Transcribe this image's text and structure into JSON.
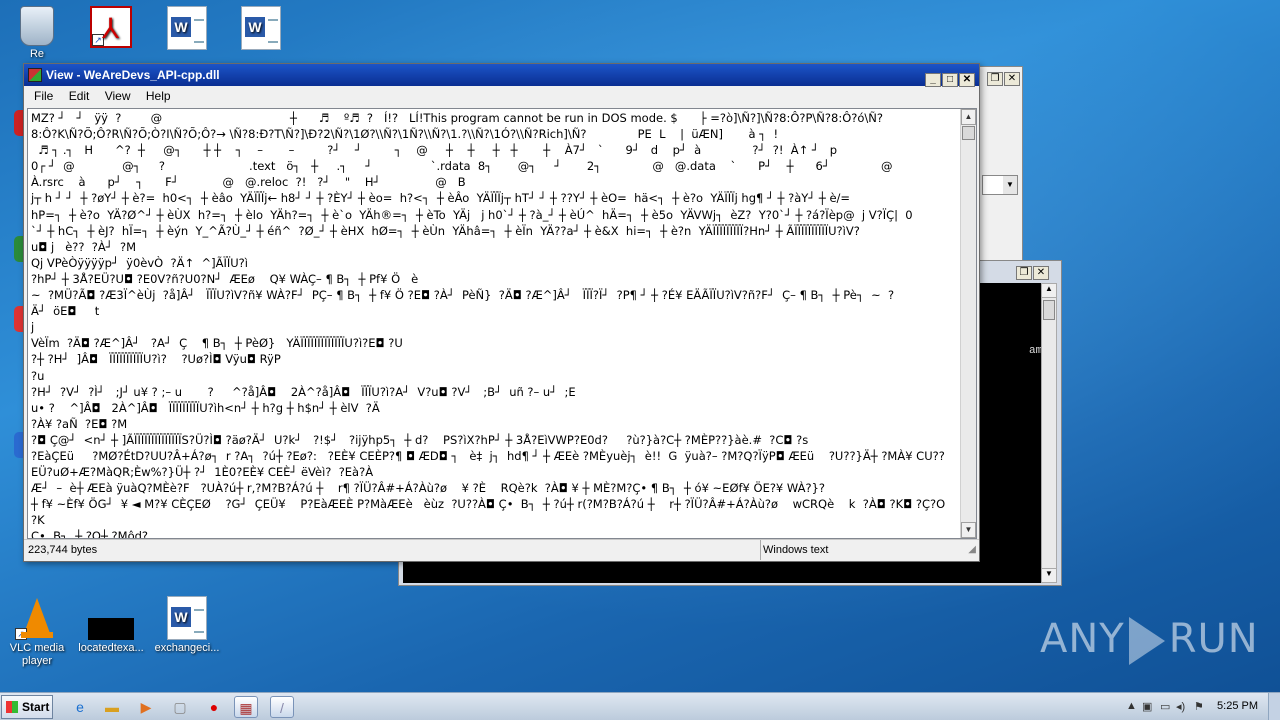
{
  "desktop": {
    "icons_top": [
      {
        "label": "Re",
        "kind": "recycle"
      },
      {
        "label": "",
        "kind": "pdf"
      },
      {
        "label": "",
        "kind": "word"
      },
      {
        "label": "",
        "kind": "word"
      }
    ],
    "icons_bottom": [
      {
        "label": "VLC media player",
        "kind": "vlc"
      },
      {
        "label": "locatedtexa...",
        "kind": "black"
      },
      {
        "label": "exchangeci...",
        "kind": "word"
      }
    ]
  },
  "viewer": {
    "title": "View - WeAreDevs_API-cpp.dll",
    "menu": [
      "File",
      "Edit",
      "View",
      "Help"
    ],
    "lines": [
      "MZ? ┘   ┘   ÿÿ  ?        @                                   ┼      ♬    º♬  ?   Í!?   LÍ!This program cannot be run in DOS mode. $      ├ =?ò]\\Ñ?]\\Ñ?8:Ô?P\\Ñ?8:Ô?ó\\Ñ?",
      "8:Ô?K\\Ñ?Õ;Ô?R\\Ñ?Õ;Ò?I\\Ñ?Õ;Ô?→ \\Ñ?8:Ð?T\\Ñ?]\\Ð?2\\Ñ?\\1Ø?\\\\Ñ?\\1Ñ?\\\\Ñ?\\1.?\\\\Ñ?\\1Ó?\\\\Ñ?Rich]\\Ñ?              PE  L    |  üÆN]       à ┐  !",
      "  ♬ ┐ .┐   H      ^?  ┼     @┐      ┼ ┼    ┐    –       –         ?┘    ┘         ┐    @     ┼    ┼     ┼   ┼       ┼    À7┘   `      9┘   d    p┘  à              ?┘  ?!  À↑ ┘   p",
      "0┌ ┘  @             @┐     ?                       .text   ö┐   ┼     .┐     ┘                `.rdata  8┐       @┐     ┘       2┐              @   @.data    `      P┘    ┼      6┘              @",
      "À.rsrc    à      p┘    ┐      F┘            @   @.reloc  ?!   ?┘    \"    H┘               @   B",
      "j┬ h ┘ ┘  ┼ ?øY┘ ┼ è?=  h0<┐  ┼ èâo  YÄÏÏÏj← h8┘ ┘ ┼ ?ÈY┘ ┼ èo=  h?<┐  ┼ èÂo  YÄÏÏÏj┬ hT┘ ┘ ┼ ??Y┘ ┼ èO=  hä<┐  ┼ è?o  YÄÏÏÏj hg¶ ┘ ┼ ?àY┘ ┼ è/=",
      "hP=┐  ┼ è?o  YÄ?Ø^┘ ┼ èÙX  h?=┐  ┼ èlo  YÄh?=┐  ┼ è`o  YÄh®=┐  ┼ èTo  YÄj   j h0`┘ ┼ ?à_┘ ┼ èÚ^  hÄ=┐  ┼ è5o  YÄVWj┐  èZ?  Y?0`┘ ┼ ?á?Ïèp@  j V?ÏÇ|  0",
      "`┘ ┼ hC┐  ┼ èJ?  hÏ=┐  ┼ èýn  Y_^Ã?Ù_┘ ┼ éñ^  ?Ø_┘ ┼ èHX  hØ=┐  ┼ èÙn  YÄhâ=┐  ┼ èÏn  YÄ??a┘ ┼ è&X  hi=┐  ┼ è?n  YÄÏÏÏÏÏÏÏÏÏ?Hn┘ ┼ ÃÏÏÏÏÏÏÏÏÏÏU?ìV?",
      "u◘ j   è??  ?À┘  ?M",
      "Qj VPèÒÿÿÿÿp┘  ÿ0èvÒ  ?Ä↑  ^]ÃÏÏU?ì",
      "?hP┘ ┼ 3Å?EÜ?U◘ ?E0V?ñ?U0?N┘  ÆEø    Q¥ WÀÇ– ¶ B┐  ┼ Pf¥ Ö   è",
      "~  ?MÜ?Ã◘ ?Æ3Ï^èÙj  ?å]Â┘   ÏÏÏU?ìV?ñ¥ WÀ?F┘  PÇ– ¶ B┐  ┼ f¥ Ö ?E◘ ?À┘  PèÑ}  ?Ä◘ ?Æ^]Â┘   ÏÏÏ?Ï┘  ?P¶ ┘ ┼ ?É¥ EÄÃÏÏU?ìV?ñ?F┘  Ç– ¶ B┐  ┼ Pè┐  ~  ?",
      "Ä┘  öE◘     t",
      "j",
      "VèÏm  ?Ä◘ ?Æ^]Â┘   ?A┘  Ç    ¶ B┐  ┼ PèØ}   YÄÏÏÏÏÏÏÏÏÏÏÏÏÏU?ì?E◘ ?U",
      "?┼ ?H┘  ]Â◘   ÏÏÏÏÏÏÏÏÏÏU?ì?    ?Uø?Ì◘ Vÿu◘ RÿP",
      "?u",
      "?H┘  ?V┘  ?Ì┘   ;J┘ u¥ ? ;– u       ?     ^?å]Â◘    2À^?å]Â◘   ÏÏÏU?ì?A┘  V?u◘ ?V┘   ;B┘  uñ ?– u┘  ;E",
      "u• ?    ^]Â◘   2À^]Â◘   ÏÏÏÏÏÏÏÏÏU?ìh<n┘ ┼ h?g ┼ h$n┘ ┼ èlV  ?Ä",
      "?À¥ ?aÑ  ?E◘ ?M",
      "?◘ Ç@┘  <n┘ ┼ ]ÃÏÏÏÏÏÏÏÏÏÏÏÏÏÏS?Ü?Ì◘ ?äø?Ä┘  U?k┘   ?!$┘   ?ijÿhp5┐  ┼ d?    PS?ìX?hP┘ ┼ 3Å?EìVWP?E0d?     ?ù?}à?C┼ ?MÈP??}àè.#  ?C◘ ?s",
      "?EàÇEü     ?MØ?ÉtD?UU?Â+Á?ø┐  r ?A┐  ?ú┼ ?Eø?:   ?EÈ¥ CEÈP?¶ ◘ ÆD◘ ┐   è‡  j┐  hd¶ ┘ ┼ ÆEè ?MÈyuèj┐  è!!  G  ÿuà?– ?M?Q?ÏÿP◘ ÆEü    ?U??}Ä┼ ?MÀ¥ CU??",
      "EÜ?uØ+Æ?MàQR;Èw%?}Ü┼ ?┘  1È0?EÈ¥ CEÈ┘ ëVèì?  ?Eà?À",
      "Æ┘  –  è┼ ÆEà ÿuàQ?MÈè?F   ?UÀ?ú┼ r,?M?B?Á?ú ┼    r¶ ?ÏÜ?Â#+Á?Àù?ø    ¥ ?È    RQè?k  ?À◘ ¥ ┼ MÈ?M?Ç• ¶ B┐  ┼ ó¥ ~EØf¥ ÖE?¥ WÀ?}?",
      "┼ f¥ ~Èf¥ ÖG┘  ¥ ◄ M?¥ CÈÇEØ    ?G┘  ÇEÜ¥    P?EàÆEÈ P?MàÆEè   èùz  ?U??À◘ Ç•  B┐  ┼ ?ú┼ r(?M?B?Á?ú ┼    r┼ ?ÏÜ?Â#+Á?Àù?ø    wCRQè    k  ?À◘ ?K◘ ?Ç?O",
      "?K",
      "Ç•  B┐  ┼ ?O┼ ?Môd?"
    ],
    "status_size": "223,744 bytes",
    "status_encoding": "Windows text"
  },
  "background_window": {
    "console_text": "am"
  },
  "taskbar": {
    "start_label": "Start",
    "items": [
      "ie-icon",
      "explorer-icon",
      "media-icon",
      "opera-icon",
      "viewer-icon",
      "blank-icon"
    ],
    "time": "5:25 PM"
  },
  "watermark": {
    "left": "ANY",
    "right": "RUN"
  }
}
